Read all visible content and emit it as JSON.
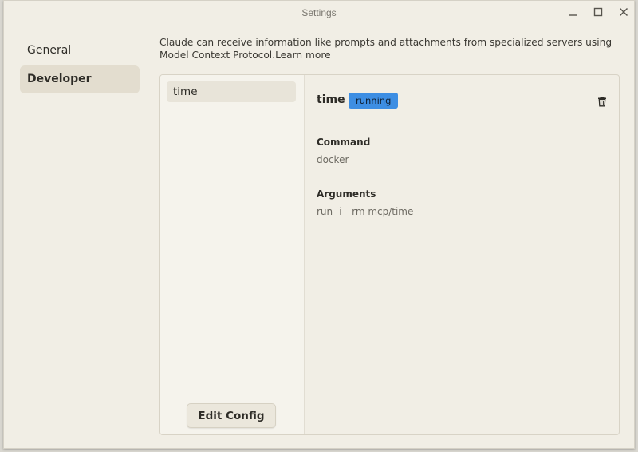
{
  "window": {
    "title": "Settings"
  },
  "nav": {
    "items": [
      {
        "label": "General"
      },
      {
        "label": "Developer"
      }
    ]
  },
  "intro": {
    "text": "Claude can receive information like prompts and attachments from specialized servers using Model Context Protocol.",
    "link": "Learn more"
  },
  "servers": {
    "items": [
      {
        "label": "time"
      }
    ],
    "edit_config_label": "Edit Config"
  },
  "detail": {
    "name": "time",
    "status": "running",
    "command_label": "Command",
    "command_value": "docker",
    "arguments_label": "Arguments",
    "arguments_value": "run -i --rm mcp/time"
  },
  "icons": {
    "minimize": "minimize-icon",
    "maximize": "maximize-icon",
    "close": "close-icon",
    "delete": "trash-icon"
  },
  "colors": {
    "background": "#f1eee5",
    "active_nav": "#e3ddcf",
    "status_running": "#3d8ee3"
  }
}
